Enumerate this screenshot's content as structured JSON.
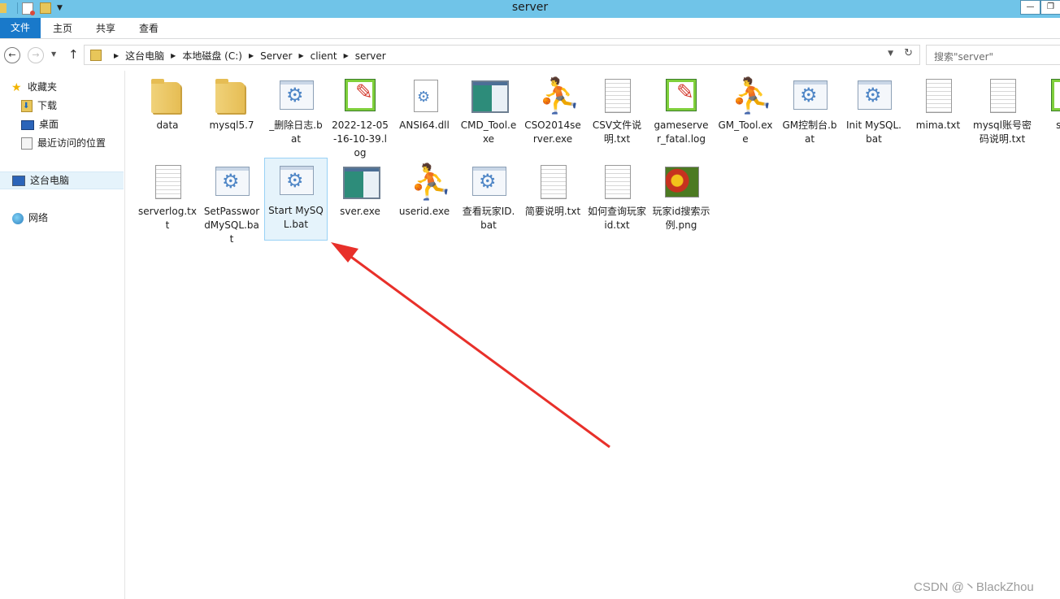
{
  "window": {
    "title": "server",
    "minimize_glyph": "—",
    "restore_glyph": "❐"
  },
  "ribbon": {
    "file_tab": "文件",
    "tabs": [
      "主页",
      "共享",
      "查看"
    ]
  },
  "nav": {
    "back_glyph": "←",
    "forward_glyph": "→",
    "up_glyph": "↑",
    "breadcrumbs": [
      "这台电脑",
      "本地磁盘 (C:)",
      "Server",
      "client",
      "server"
    ],
    "search_placeholder": "搜索\"server\""
  },
  "sidebar": {
    "favorites": {
      "label": "收藏夹",
      "items": [
        "下载",
        "桌面",
        "最近访问的位置"
      ]
    },
    "this_pc": "这台电脑",
    "network": "网络"
  },
  "files": [
    {
      "name": "data",
      "icon": "folder-icon"
    },
    {
      "name": "mysql5.7",
      "icon": "folder-icon"
    },
    {
      "name": "_删除日志.bat",
      "icon": "batch-file-icon"
    },
    {
      "name": "2022-12-05-16-10-39.log",
      "icon": "log-file-icon"
    },
    {
      "name": "ANSI64.dll",
      "icon": "dll-file-icon"
    },
    {
      "name": "CMD_Tool.exe",
      "icon": "application-icon"
    },
    {
      "name": "CSO2014server.exe",
      "icon": "counter-strike-icon"
    },
    {
      "name": "CSV文件说明.txt",
      "icon": "text-file-icon"
    },
    {
      "name": "gameserver_fatal.log",
      "icon": "log-file-icon"
    },
    {
      "name": "GM_Tool.exe",
      "icon": "counter-strike-icon"
    },
    {
      "name": "GM控制台.bat",
      "icon": "batch-file-icon"
    },
    {
      "name": "Init MySQL.bat",
      "icon": "batch-file-icon"
    },
    {
      "name": "mima.txt",
      "icon": "text-file-icon"
    },
    {
      "name": "mysql账号密码说明.txt",
      "icon": "text-file-icon"
    },
    {
      "name": "serv",
      "icon": "log-file-icon"
    },
    {
      "name": "serverlog.txt",
      "icon": "text-file-icon"
    },
    {
      "name": "SetPasswordMySQL.bat",
      "icon": "batch-file-icon"
    },
    {
      "name": "Start MySQL.bat",
      "icon": "batch-file-icon",
      "selected": true
    },
    {
      "name": "sver.exe",
      "icon": "application-icon"
    },
    {
      "name": "userid.exe",
      "icon": "counter-strike-icon"
    },
    {
      "name": "查看玩家ID.bat",
      "icon": "batch-file-icon"
    },
    {
      "name": "简要说明.txt",
      "icon": "text-file-icon"
    },
    {
      "name": "如何查询玩家id.txt",
      "icon": "text-file-icon"
    },
    {
      "name": "玩家id搜索示例.png",
      "icon": "image-file-icon"
    }
  ],
  "annotation": {
    "color": "#e8302a"
  },
  "watermark": "CSDN @丶BlackZhou"
}
